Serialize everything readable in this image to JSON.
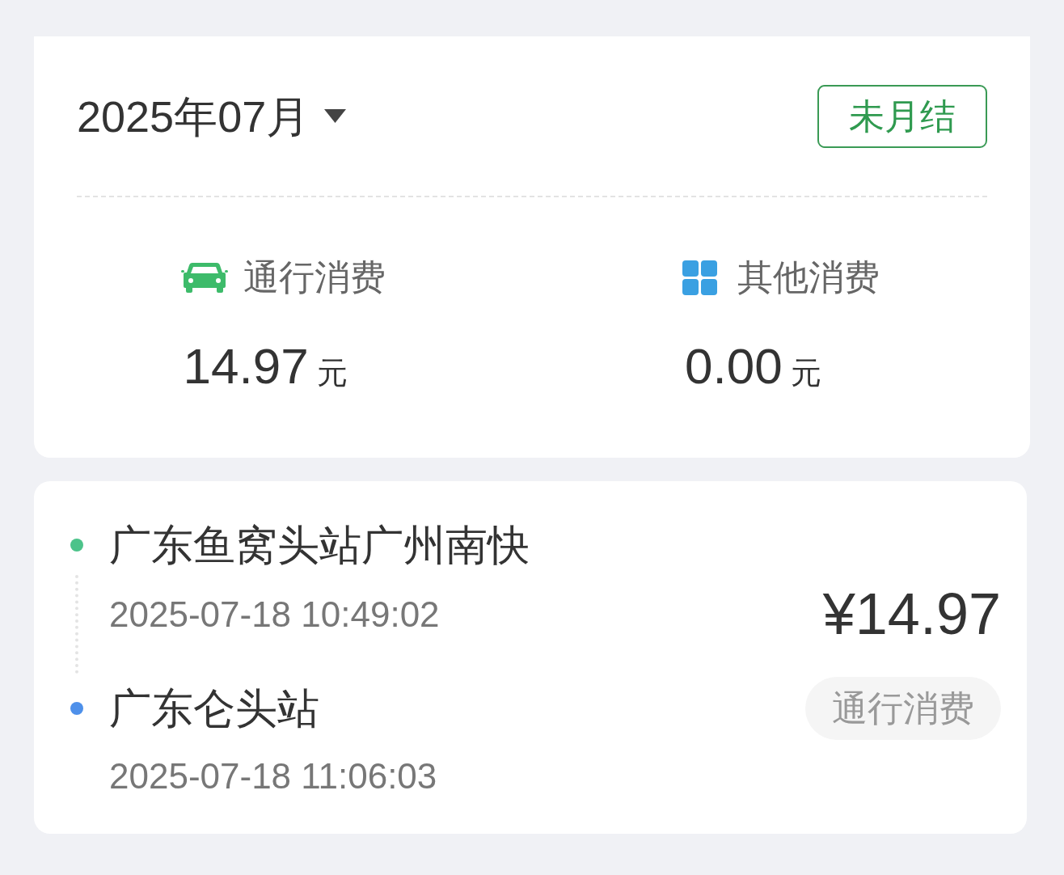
{
  "header": {
    "month": "2025年07月",
    "status_badge": "未月结"
  },
  "summary": [
    {
      "kind": "toll",
      "label": "通行消费",
      "amount": "14.97",
      "unit": "元"
    },
    {
      "kind": "other",
      "label": "其他消费",
      "amount": "0.00",
      "unit": "元"
    }
  ],
  "trips": [
    {
      "entry": {
        "station": "广东鱼窝头站广州南快",
        "time": "2025-07-18 10:49:02",
        "color": "#4cc38a"
      },
      "exit": {
        "station": "广东仑头站",
        "time": "2025-07-18 11:06:03",
        "color": "#4e90ea"
      },
      "amount": "¥14.97",
      "category": "通行消费"
    }
  ]
}
